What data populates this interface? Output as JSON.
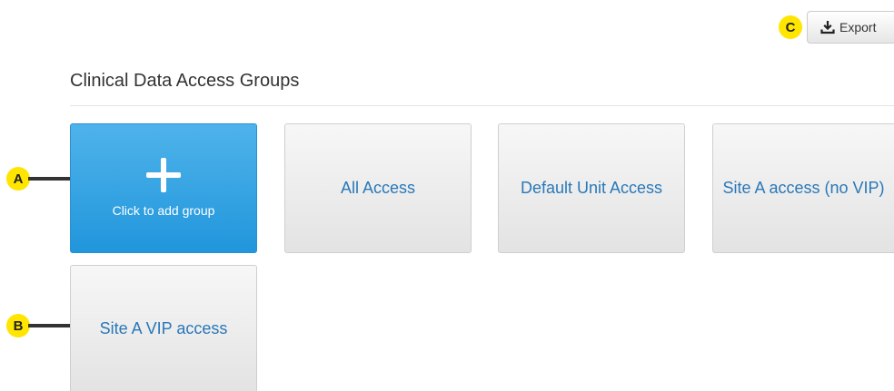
{
  "markers": {
    "a": "A",
    "b": "B",
    "c": "C"
  },
  "toolbar": {
    "export_label": "Export",
    "export_icon": "download-icon"
  },
  "page": {
    "title": "Clinical Data Access Groups"
  },
  "tiles": {
    "add_group_label": "Click to add group",
    "add_group_icon": "plus-icon",
    "groups": [
      "All Access",
      "Default Unit Access",
      "Site A access (no VIP)",
      "Site A VIP access"
    ]
  },
  "colors": {
    "accent": "#2196dc",
    "link": "#2a78b8",
    "marker": "#ffe500"
  }
}
